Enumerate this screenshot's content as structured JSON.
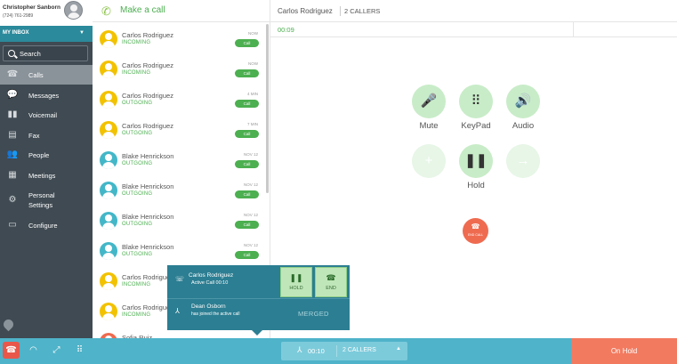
{
  "profile": {
    "name": "Christopher Sanborn",
    "phone": "(724) 761-2989"
  },
  "inbox": {
    "label": "MY INBOX"
  },
  "search": {
    "label": "Search"
  },
  "nav": [
    {
      "label": "Calls",
      "icon": "phone-icon",
      "active": true
    },
    {
      "label": "Messages",
      "icon": "chat-icon"
    },
    {
      "label": "Voicemail",
      "icon": "voicemail-icon"
    },
    {
      "label": "Fax",
      "icon": "fax-icon"
    },
    {
      "label": "People",
      "icon": "people-icon"
    },
    {
      "label": "Meetings",
      "icon": "meetings-icon"
    },
    {
      "label": "Personal",
      "label2": "Settings",
      "icon": "gear-icon"
    },
    {
      "label": "Configure",
      "icon": "configure-icon"
    }
  ],
  "list_header": {
    "label": "Make a call"
  },
  "calls": [
    {
      "name": "Carlos Rodriguez",
      "dir": "INCOMING",
      "time": "NOW",
      "btn": "Call",
      "color": "#f2c200"
    },
    {
      "name": "Carlos Rodriguez",
      "dir": "INCOMING",
      "time": "NOW",
      "btn": "Call",
      "color": "#f2c200"
    },
    {
      "name": "Carlos Rodriguez",
      "dir": "OUTGOING",
      "time": "4 MIN",
      "btn": "Call",
      "color": "#f2c200"
    },
    {
      "name": "Carlos Rodriguez",
      "dir": "OUTGOING",
      "time": "7 MIN",
      "btn": "Call",
      "color": "#f2c200"
    },
    {
      "name": "Blake Henrickson",
      "dir": "OUTGOING",
      "time": "NOV 12",
      "btn": "Call",
      "color": "#43b7c8"
    },
    {
      "name": "Blake Henrickson",
      "dir": "OUTGOING",
      "time": "NOV 12",
      "btn": "Call",
      "color": "#43b7c8"
    },
    {
      "name": "Blake Henrickson",
      "dir": "OUTGOING",
      "time": "NOV 12",
      "btn": "Call",
      "color": "#43b7c8"
    },
    {
      "name": "Blake Henrickson",
      "dir": "OUTGOING",
      "time": "NOV 12",
      "btn": "Call",
      "color": "#43b7c8"
    },
    {
      "name": "Carlos Rodriguez",
      "dir": "INCOMING",
      "time": "",
      "btn": "",
      "color": "#f2c200"
    },
    {
      "name": "Carlos Rodriguez",
      "dir": "INCOMING",
      "time": "",
      "btn": "",
      "color": "#f2c200"
    },
    {
      "name": "Sofia Ruiz",
      "dir": "",
      "time": "",
      "btn": "",
      "color": "#ef6b50"
    }
  ],
  "main": {
    "caller_name": "Carlos Rodriguez",
    "callers": "2 CALLERS",
    "timer": "00:09"
  },
  "controls": {
    "mute": "Mute",
    "keypad": "KeyPad",
    "audio": "Audio",
    "hold": "Hold",
    "end_call": "END CALL"
  },
  "popup": {
    "name": "Carlos Rodriguez",
    "status": "Active Call 00:10",
    "hold": "HOLD",
    "end": "END",
    "joined_name": "Dean Osborn",
    "joined_msg": "has joined the active call",
    "merged": "MERGED"
  },
  "bottom": {
    "timer": "00:10",
    "callers": "2 CALLERS",
    "on_hold": "On Hold"
  },
  "colors": {
    "sidebar": "#3f4a52",
    "accent_teal": "#4fb3c9",
    "accent_green": "#4caf50",
    "end_red": "#ef6b50"
  }
}
